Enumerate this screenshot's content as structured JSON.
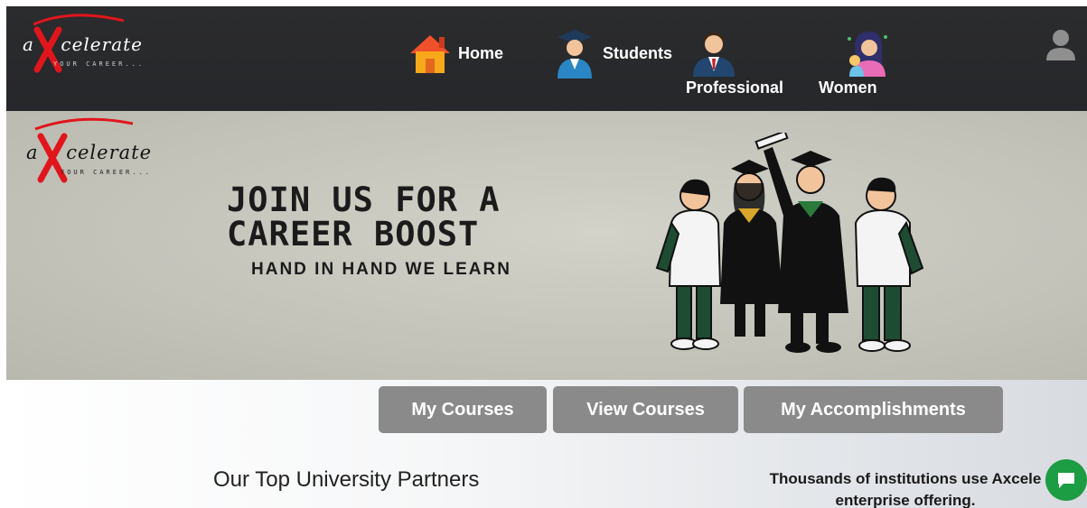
{
  "brand": {
    "name": "celerate",
    "prefix": "a",
    "tagline": "YOUR CAREER...",
    "accent_color": "#e0161c"
  },
  "nav": {
    "items": [
      {
        "label": "Home",
        "icon": "home-icon"
      },
      {
        "label": "Students",
        "icon": "graduate-student-icon"
      },
      {
        "label": "Professional",
        "icon": "businessman-icon"
      },
      {
        "label": "Women",
        "icon": "woman-icon"
      }
    ],
    "user_icon": "user-avatar-icon",
    "background": "#2a2b2d"
  },
  "hero": {
    "title_line1": "JOIN US FOR A",
    "title_line2": "CAREER BOOST",
    "subtitle": "HAND IN HAND WE LEARN",
    "art": "graduating-students-illustration"
  },
  "actions": {
    "my_courses": "My Courses",
    "view_courses": "View Courses",
    "my_accomplishments": "My Accomplishments",
    "button_color": "#8a8a8a"
  },
  "partners": {
    "title": "Our Top University Partners"
  },
  "institutions": {
    "line1": "Thousands of institutions use Axcele",
    "line2": "enterprise offering."
  },
  "chat": {
    "icon": "chat-bubble-icon",
    "color": "#1c9c43"
  }
}
